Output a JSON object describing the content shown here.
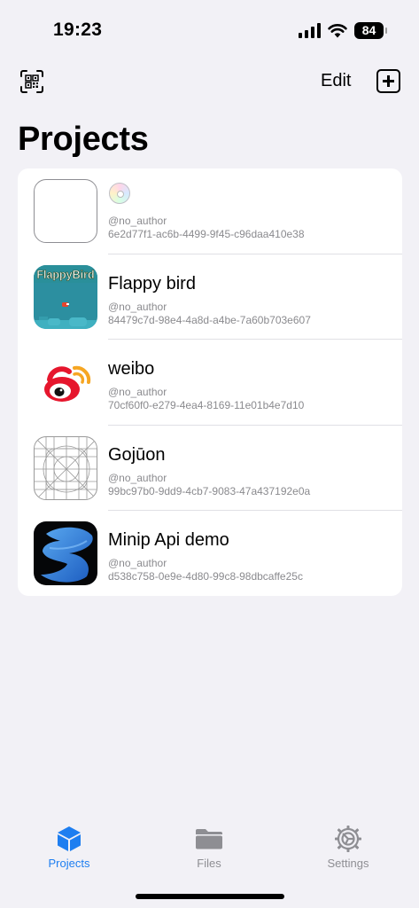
{
  "status_bar": {
    "time": "19:23",
    "battery": "84"
  },
  "nav": {
    "scan_icon": "qr-scan-icon",
    "edit_label": "Edit",
    "add_icon": "plus-square-icon"
  },
  "page": {
    "title": "Projects"
  },
  "projects": [
    {
      "title": "",
      "title_icon": "cd-icon",
      "thumb": "empty",
      "author": "@no_author",
      "id": "6e2d77f1-ac6b-4499-9f45-c96daa410e38"
    },
    {
      "title": "Flappy bird",
      "thumb": "flappy-bird",
      "thumb_text": "FlappyBird",
      "author": "@no_author",
      "id": "84479c7d-98e4-4a8d-a4be-7a60b703e607"
    },
    {
      "title": "weibo",
      "thumb": "weibo",
      "author": "@no_author",
      "id": "70cf60f0-e279-4ea4-8169-11e01b4e7d10"
    },
    {
      "title": "Gojūon",
      "thumb": "icon-grid",
      "author": "@no_author",
      "id": "99bc97b0-9dd9-4cb7-9083-47a437192e0a"
    },
    {
      "title": "Minip Api demo",
      "thumb": "swift",
      "author": "@no_author",
      "id": "d538c758-0e9e-4d80-99c8-98dbcaffe25c"
    }
  ],
  "tabs": [
    {
      "label": "Projects",
      "icon": "cube-icon",
      "active": true
    },
    {
      "label": "Files",
      "icon": "folder-icon",
      "active": false
    },
    {
      "label": "Settings",
      "icon": "gear-icon",
      "active": false
    }
  ],
  "colors": {
    "accent": "#1e7ef0",
    "background": "#f2f1f6",
    "secondary_text": "#8a8a8e"
  }
}
